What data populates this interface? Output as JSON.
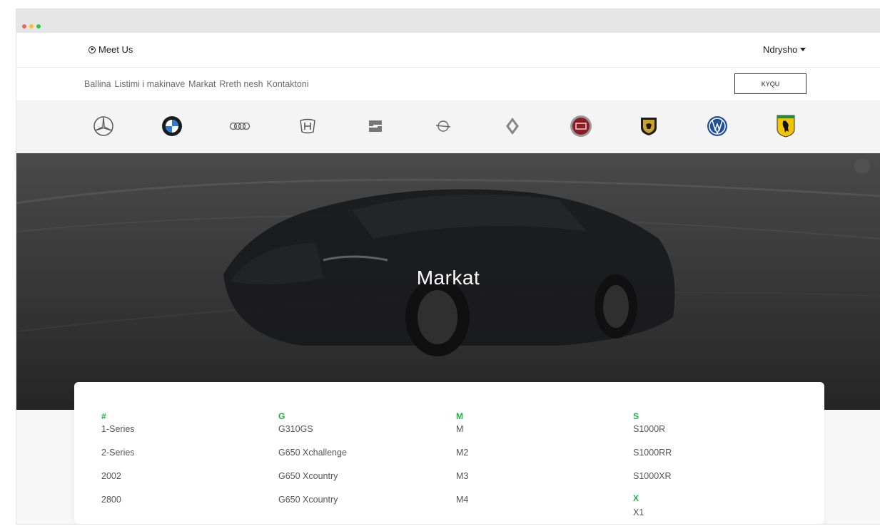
{
  "topbar": {
    "meet_label": "Meet Us",
    "language_label": "Ndrysho"
  },
  "nav": {
    "items": [
      "Ballina",
      "Listimi i makinave",
      "Markat",
      "Rreth nesh",
      "Kontaktoni"
    ],
    "login_label": "KYQU"
  },
  "brands": [
    "mercedes-icon",
    "bmw-icon",
    "audi-icon",
    "honda-icon",
    "seat-icon",
    "opel-icon",
    "renault-icon",
    "fiat-icon",
    "lamborghini-icon",
    "volkswagen-icon",
    "ferrari-icon"
  ],
  "hero": {
    "title": "Markat"
  },
  "models": {
    "columns": [
      {
        "header": "#",
        "items": [
          "1-Series",
          "2-Series",
          "2002",
          "2800"
        ]
      },
      {
        "header": "G",
        "items": [
          "G310GS",
          "G650 Xchallenge",
          "G650 Xcountry",
          "G650 Xcountry"
        ]
      },
      {
        "header": "M",
        "items": [
          "M",
          "M2",
          "M3",
          "M4"
        ]
      },
      {
        "header": "S",
        "items": [
          "S1000R",
          "S1000RR",
          "S1000XR"
        ],
        "next_header": "X",
        "next_items": [
          "X1"
        ]
      }
    ]
  },
  "colors": {
    "accent": "#1fae43",
    "hero_overlay": "#3a3a3a"
  }
}
